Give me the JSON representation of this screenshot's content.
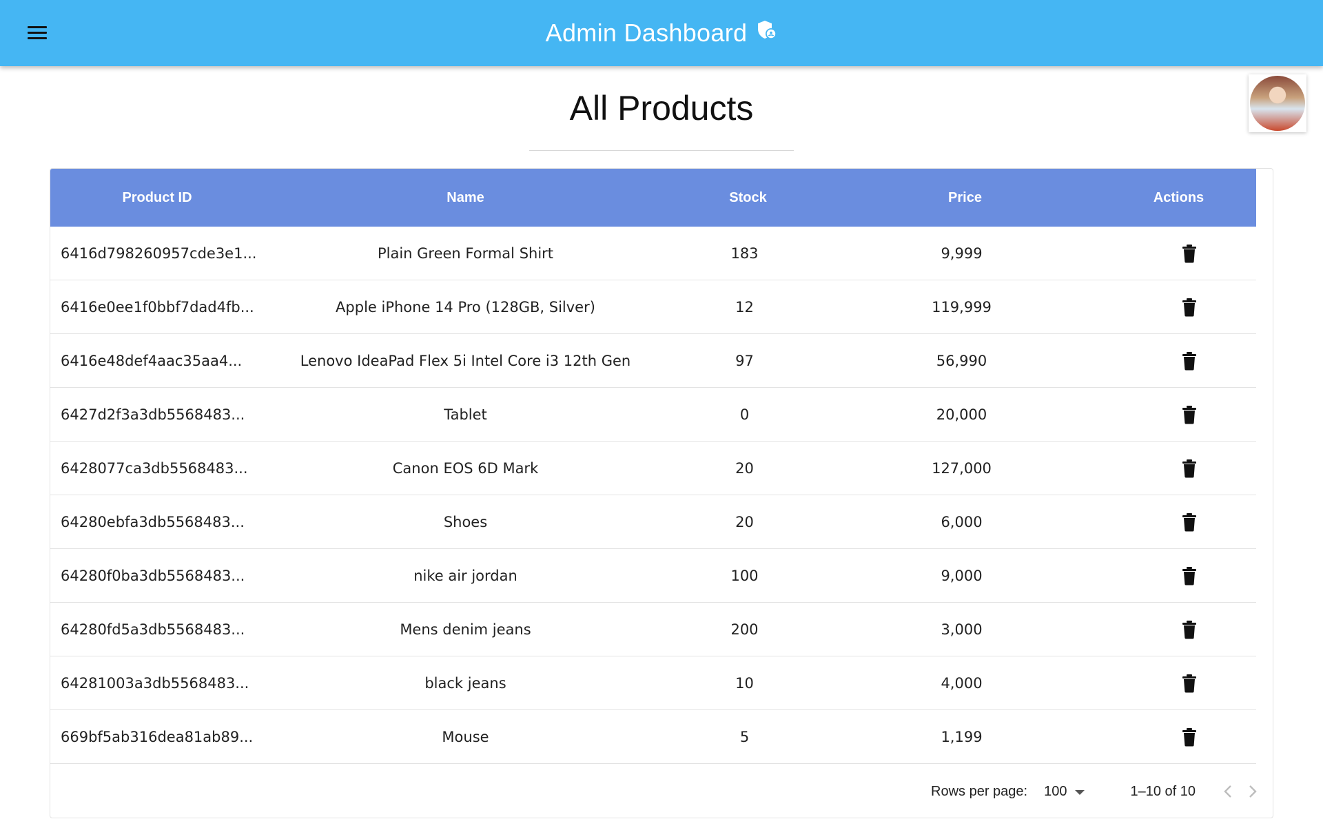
{
  "appbar": {
    "title": "Admin Dashboard",
    "menu_icon": "hamburger-menu-icon",
    "admin_icon": "admin-shield-icon",
    "color": "#45b6f3"
  },
  "page": {
    "heading": "All Products"
  },
  "table": {
    "header_color": "#6a8ddf",
    "columns": [
      "Product ID",
      "Name",
      "Stock",
      "Price",
      "Actions"
    ],
    "rows": [
      {
        "id": "6416d798260957cde3e1...",
        "name": "Plain Green Formal Shirt",
        "stock": "183",
        "price": "9,999"
      },
      {
        "id": "6416e0ee1f0bbf7dad4fb...",
        "name": "Apple iPhone 14 Pro (128GB, Silver)",
        "stock": "12",
        "price": "119,999"
      },
      {
        "id": "6416e48def4aac35aa4...",
        "name": "Lenovo IdeaPad Flex 5i Intel Core i3 12th Gen",
        "stock": "97",
        "price": "56,990"
      },
      {
        "id": "6427d2f3a3db5568483...",
        "name": "Tablet",
        "stock": "0",
        "price": "20,000"
      },
      {
        "id": "6428077ca3db5568483...",
        "name": "Canon EOS 6D Mark",
        "stock": "20",
        "price": "127,000"
      },
      {
        "id": "64280ebfa3db5568483...",
        "name": "Shoes",
        "stock": "20",
        "price": "6,000"
      },
      {
        "id": "64280f0ba3db5568483...",
        "name": "nike air jordan",
        "stock": "100",
        "price": "9,000"
      },
      {
        "id": "64280fd5a3db5568483...",
        "name": "Mens denim jeans",
        "stock": "200",
        "price": "3,000"
      },
      {
        "id": "64281003a3db5568483...",
        "name": "black jeans",
        "stock": "10",
        "price": "4,000"
      },
      {
        "id": "669bf5ab316dea81ab89...",
        "name": "Mouse",
        "stock": "5",
        "price": "1,199"
      }
    ],
    "action_icon": "trash-icon"
  },
  "pagination": {
    "rows_per_page_label": "Rows per page:",
    "rows_per_page_value": "100",
    "range_text": "1–10 of 10",
    "prev_icon": "chevron-left-icon",
    "next_icon": "chevron-right-icon"
  }
}
